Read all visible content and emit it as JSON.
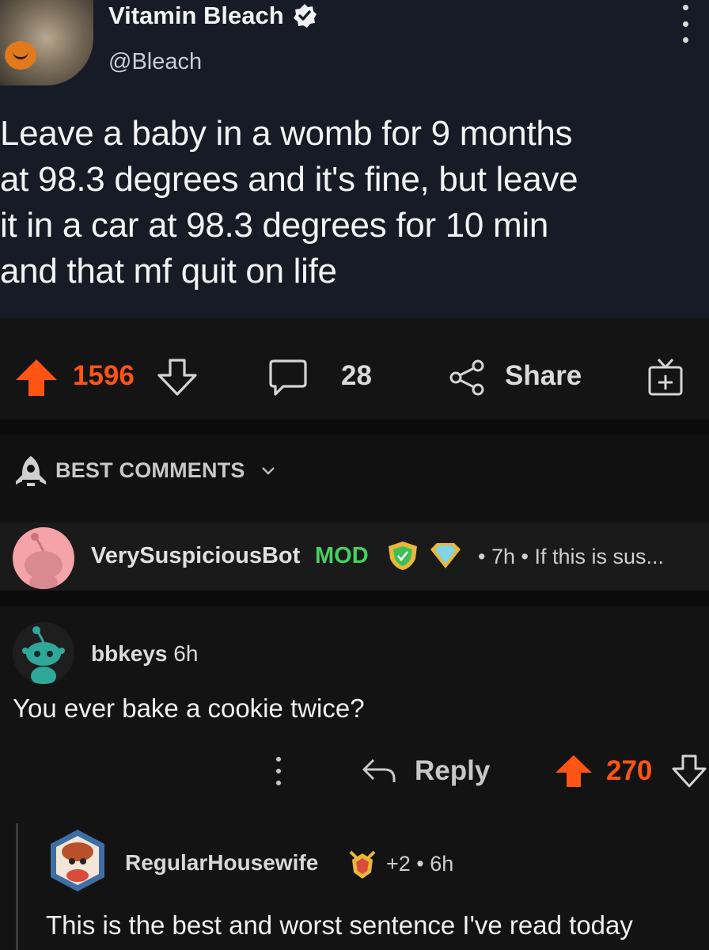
{
  "tweet": {
    "name": "Vitamin Bleach",
    "handle": "@Bleach",
    "lines": [
      "Leave a baby in a womb for 9 months",
      "at 98.3 degrees and it's fine, but leave",
      "it in a car at 98.3 degrees for 10 min",
      "and that mf quit on life"
    ]
  },
  "post_actions": {
    "upvotes": "1596",
    "comments": "28",
    "share_label": "Share"
  },
  "sort": {
    "label": "BEST COMMENTS"
  },
  "mod_comment": {
    "username": "VerySuspiciousBot",
    "tag": "MOD",
    "meta": "• 7h • If this is sus..."
  },
  "comment": {
    "username": "bbkeys",
    "age": "6h",
    "text": "You ever bake a cookie twice?",
    "reply_label": "Reply",
    "votes": "270"
  },
  "reply": {
    "username": "RegularHousewife",
    "meta": "+2 • 6h",
    "text": "This is the best and worst sentence I've read today"
  },
  "colors": {
    "upvote": "#ff5414",
    "mod_green": "#46d160",
    "background": "#121212",
    "tweet_bg": "#161b26"
  },
  "icons": [
    "verified-icon",
    "more-icon",
    "upvote-icon",
    "downvote-icon",
    "comment-icon",
    "share-icon",
    "award-icon",
    "rocket-icon",
    "chevron-down-icon",
    "reply-icon"
  ]
}
